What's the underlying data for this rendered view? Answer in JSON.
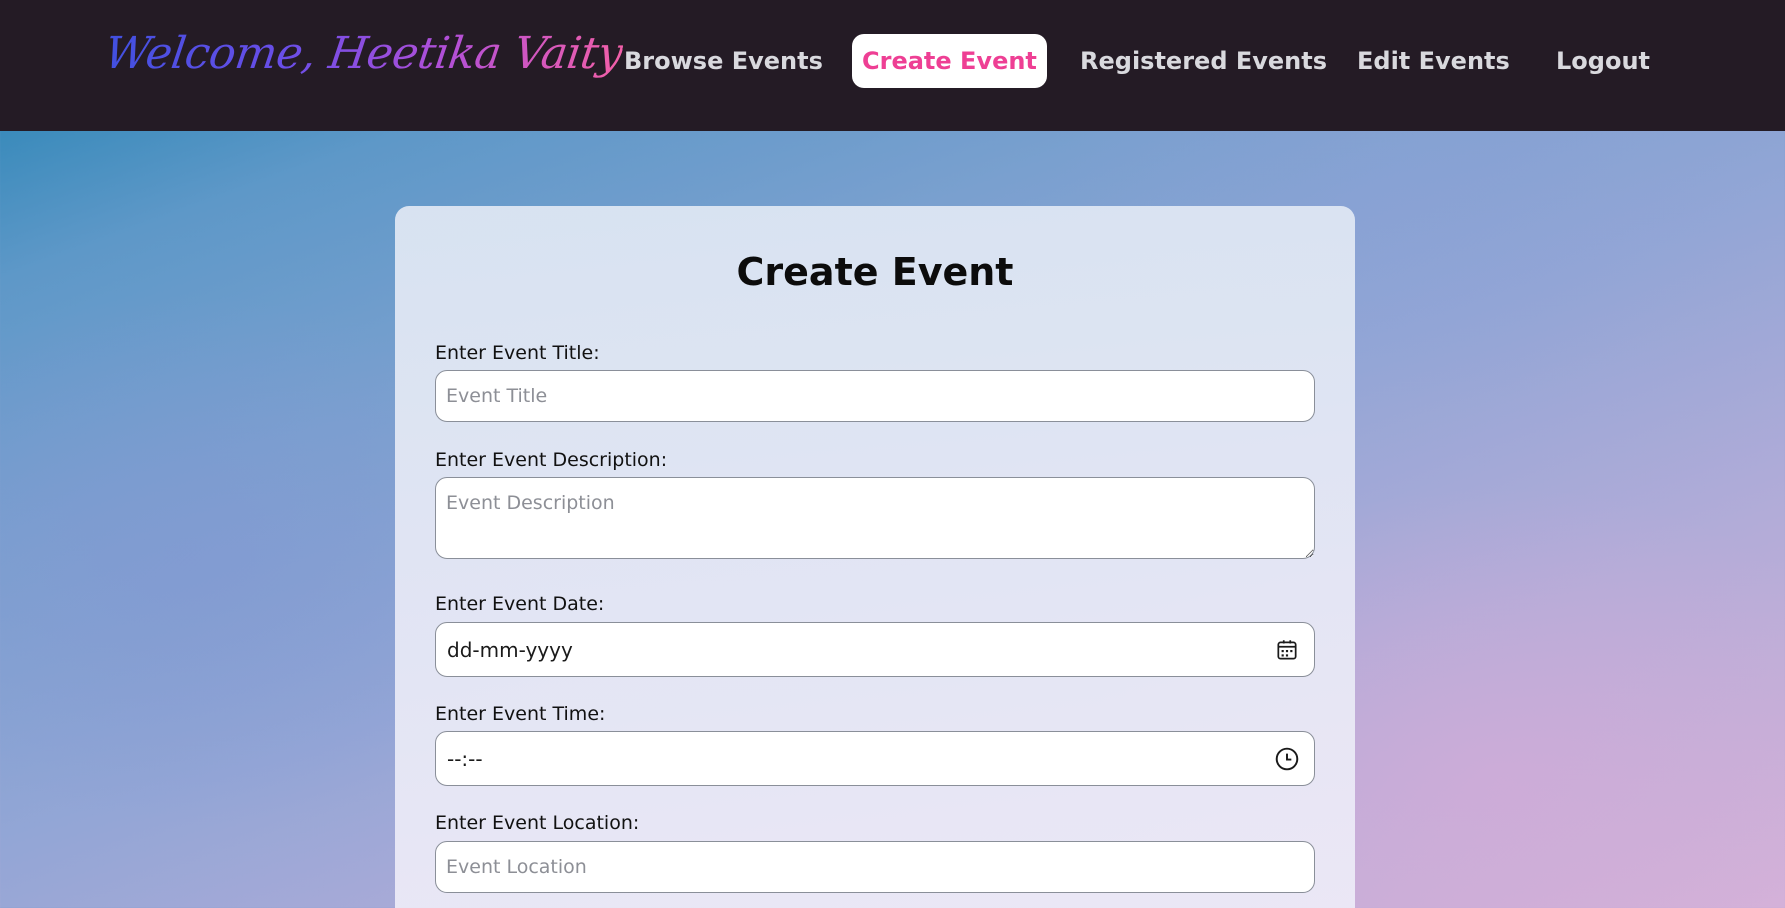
{
  "header": {
    "brand": "Welcome, Heetika Vaity",
    "nav": [
      {
        "label": "Browse Events"
      },
      {
        "label": "Create Event",
        "active": true
      },
      {
        "label": "Registered Events"
      },
      {
        "label": "Edit Events"
      },
      {
        "label": "Logout"
      }
    ],
    "colors": {
      "background": "#241b25",
      "link": "#d9d9de",
      "active_text": "#ee3f94",
      "active_background": "#ffffff"
    }
  },
  "form": {
    "title": "Create Event",
    "fields": {
      "title": {
        "label": "Enter Event Title:",
        "placeholder": "Event Title"
      },
      "description": {
        "label": "Enter Event Description:",
        "placeholder": "Event Description"
      },
      "date": {
        "label": "Enter Event Date:",
        "value": "dd-mm-yyyy",
        "icon": "calendar-icon"
      },
      "time": {
        "label": "Enter Event Time:",
        "value": "--:--",
        "icon": "clock-icon"
      },
      "location": {
        "label": "Enter Event Location:",
        "placeholder": "Event Location"
      }
    }
  }
}
